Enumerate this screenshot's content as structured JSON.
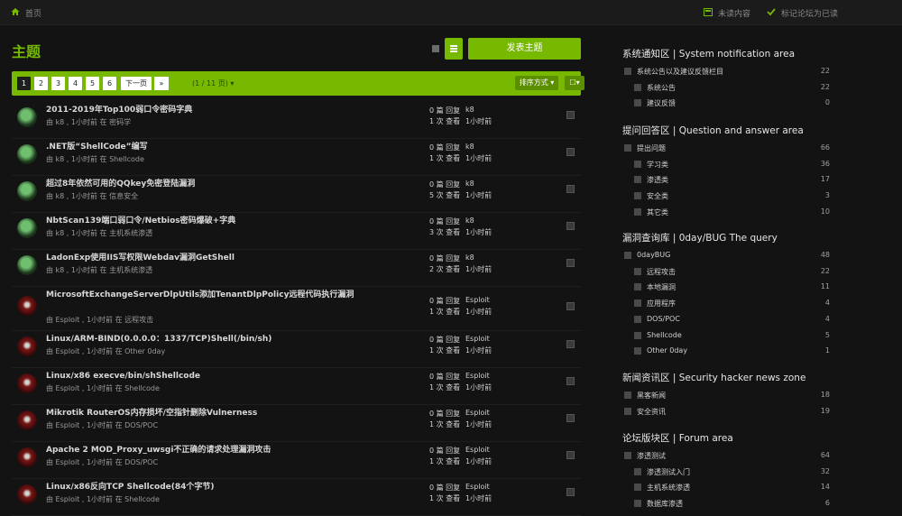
{
  "breadcrumb": {
    "home": "首页"
  },
  "top_actions": {
    "unread": "未读内容",
    "mark_read": "标记论坛为已读"
  },
  "page_title": "主题",
  "buttons": {
    "new_topic": "发表主题",
    "next": "下一页",
    "sort": "排序方式 ▾",
    "select": "☐▾",
    "last": "»"
  },
  "pagination": {
    "pages": [
      "1",
      "2",
      "3",
      "4",
      "5",
      "6"
    ],
    "current": "1",
    "info": "(1 / 11 页) ▾"
  },
  "colors": {
    "accent": "#76b900",
    "background": "#131313"
  },
  "topics": [
    {
      "title": "2011-2019年Top100弱口令密码字典",
      "meta": "由 k8 , 1小时前 在 密码学",
      "replies": "0 篇 回复",
      "views": "1 次 查看",
      "last_user": "k8",
      "last_time": "1小时前",
      "avatar": "k8-avatar"
    },
    {
      "title": ".NET版“ShellCode”编写",
      "meta": "由 k8 , 1小时前 在 Shellcode",
      "replies": "0 篇 回复",
      "views": "1 次 查看",
      "last_user": "k8",
      "last_time": "1小时前",
      "avatar": "k8-avatar"
    },
    {
      "title": "超过8年依然可用的QQkey免密登陆漏洞",
      "meta": "由 k8 , 1小时前 在 信息安全",
      "replies": "0 篇 回复",
      "views": "5 次 查看",
      "last_user": "k8",
      "last_time": "1小时前",
      "avatar": "k8-avatar"
    },
    {
      "title": "NbtScan139端口弱口令/Netbios密码爆破+字典",
      "meta": "由 k8 , 1小时前 在 主机系统渗透",
      "replies": "0 篇 回复",
      "views": "3 次 查看",
      "last_user": "k8",
      "last_time": "1小时前",
      "avatar": "k8-avatar"
    },
    {
      "title": "LadonExp使用IIS写权限Webdav漏洞GetShell",
      "meta": "由 k8 , 1小时前 在 主机系统渗透",
      "replies": "0 篇 回复",
      "views": "2 次 查看",
      "last_user": "k8",
      "last_time": "1小时前",
      "avatar": "k8-avatar"
    },
    {
      "title": "MicrosoftExchangeServerDlpUtils添加TenantDlpPolicy远程代码执行漏洞",
      "meta": "由 Esploit , 1小时前 在 远程攻击",
      "replies": "0 篇 回复",
      "views": "1 次 查看",
      "last_user": "Esploit",
      "last_time": "1小时前",
      "avatar": "esploit-avatar"
    },
    {
      "title": "Linux/ARM-BIND(0.0.0.0：1337/TCP)Shell(/bin/sh)",
      "meta": "由 Esploit , 1小时前 在 Other 0day",
      "replies": "0 篇 回复",
      "views": "1 次 查看",
      "last_user": "Esploit",
      "last_time": "1小时前",
      "avatar": "esploit-avatar"
    },
    {
      "title": "Linux/x86 execve/bin/shShellcode",
      "meta": "由 Esploit , 1小时前 在 Shellcode",
      "replies": "0 篇 回复",
      "views": "1 次 查看",
      "last_user": "Esploit",
      "last_time": "1小时前",
      "avatar": "esploit-avatar"
    },
    {
      "title": "Mikrotik RouterOS内存损坏/空指针删除Vulnerness",
      "meta": "由 Esploit , 1小时前 在 DOS/POC",
      "replies": "0 篇 回复",
      "views": "1 次 查看",
      "last_user": "Esploit",
      "last_time": "1小时前",
      "avatar": "esploit-avatar"
    },
    {
      "title": "Apache 2 MOD_Proxy_uwsgi不正确的请求处理漏洞攻击",
      "meta": "由 Esploit , 1小时前 在 DOS/POC",
      "replies": "0 篇 回复",
      "views": "1 次 查看",
      "last_user": "Esploit",
      "last_time": "1小时前",
      "avatar": "esploit-avatar"
    },
    {
      "title": "Linux/x86反向TCP Shellcode(84个字节)",
      "meta": "由 Esploit , 1小时前 在 Shellcode",
      "replies": "0 篇 回复",
      "views": "1 次 查看",
      "last_user": "Esploit",
      "last_time": "1小时前",
      "avatar": "esploit-avatar"
    }
  ],
  "sidebar": [
    {
      "title": "系统通知区 | System notification area",
      "forums": [
        {
          "name": "系统公告以及建议反馈栏目",
          "count": "22",
          "level": 0
        },
        {
          "name": "系统公告",
          "count": "22",
          "level": 1
        },
        {
          "name": "建议反馈",
          "count": "0",
          "level": 1
        }
      ]
    },
    {
      "title": "提问回答区 | Question and answer area",
      "forums": [
        {
          "name": "提出问题",
          "count": "66",
          "level": 0
        },
        {
          "name": "学习类",
          "count": "36",
          "level": 1
        },
        {
          "name": "渗透类",
          "count": "17",
          "level": 1
        },
        {
          "name": "安全类",
          "count": "3",
          "level": 1
        },
        {
          "name": "其它类",
          "count": "10",
          "level": 1
        }
      ]
    },
    {
      "title": "漏洞查询库 | 0day/BUG The query",
      "forums": [
        {
          "name": "0dayBUG",
          "count": "48",
          "level": 0
        },
        {
          "name": "远程攻击",
          "count": "22",
          "level": 1
        },
        {
          "name": "本地漏洞",
          "count": "11",
          "level": 1
        },
        {
          "name": "应用程序",
          "count": "4",
          "level": 1
        },
        {
          "name": "DOS/POC",
          "count": "4",
          "level": 1
        },
        {
          "name": "Shellcode",
          "count": "5",
          "level": 1
        },
        {
          "name": "Other 0day",
          "count": "1",
          "level": 1
        }
      ]
    },
    {
      "title": "新闻资讯区 | Security hacker news zone",
      "forums": [
        {
          "name": "黑客新闻",
          "count": "18",
          "level": 0
        },
        {
          "name": "安全资讯",
          "count": "19",
          "level": 0
        }
      ]
    },
    {
      "title": "论坛版块区 | Forum area",
      "forums": [
        {
          "name": "渗透测试",
          "count": "64",
          "level": 0
        },
        {
          "name": "渗透测试入门",
          "count": "32",
          "level": 1
        },
        {
          "name": "主机系统渗透",
          "count": "14",
          "level": 1
        },
        {
          "name": "数据库渗透",
          "count": "6",
          "level": 1
        }
      ]
    }
  ]
}
